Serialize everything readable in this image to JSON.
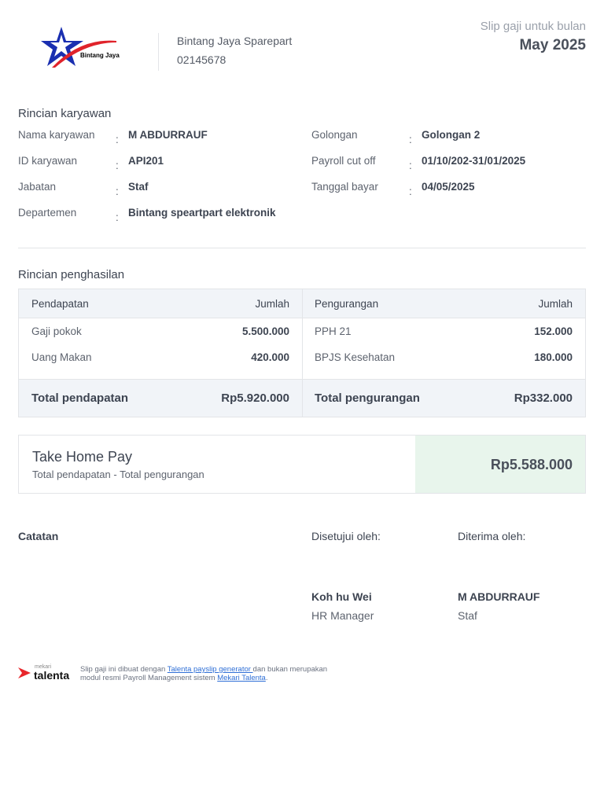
{
  "company": {
    "name": "Bintang Jaya Sparepart",
    "id": "02145678",
    "logo_text": "Bintang Jaya"
  },
  "slip": {
    "label": "Slip gaji untuk bulan",
    "month": "May 2025"
  },
  "employee": {
    "title": "Rincian karyawan",
    "sep": ":",
    "left": [
      {
        "label": "Nama karyawan",
        "value": "M ABDURRAUF"
      },
      {
        "label": "ID karyawan",
        "value": "API201"
      },
      {
        "label": "Jabatan",
        "value": "Staf"
      },
      {
        "label": "Departemen",
        "value": "Bintang speartpart elektronik"
      }
    ],
    "right": [
      {
        "label": "Golongan",
        "value": "Golongan 2"
      },
      {
        "label": "Payroll cut off",
        "value": "01/10/202-31/01/2025"
      },
      {
        "label": "Tanggal bayar",
        "value": "04/05/2025"
      }
    ]
  },
  "income": {
    "title": "Rincian penghasilan",
    "earnings": {
      "header": "Pendapatan",
      "amount_header": "Jumlah",
      "items": [
        {
          "label": "Gaji pokok",
          "value": "5.500.000"
        },
        {
          "label": "Uang Makan",
          "value": "420.000"
        }
      ],
      "total_label": "Total pendapatan",
      "total": "Rp5.920.000"
    },
    "deductions": {
      "header": "Pengurangan",
      "amount_header": "Jumlah",
      "items": [
        {
          "label": "PPH 21",
          "value": "152.000"
        },
        {
          "label": "BPJS Kesehatan",
          "value": "180.000"
        }
      ],
      "total_label": "Total pengurangan",
      "total": "Rp332.000"
    }
  },
  "take_home": {
    "title": "Take Home Pay",
    "subtitle": "Total pendapatan - Total pengurangan",
    "value": "Rp5.588.000"
  },
  "notes": {
    "label": "Catatan"
  },
  "approved": {
    "label": "Disetujui oleh:",
    "name": "Koh hu Wei",
    "role": "HR Manager"
  },
  "received": {
    "label": "Diterima oleh:",
    "name": "M ABDURRAUF",
    "role": "Staf"
  },
  "footer": {
    "brand_small": "mekari",
    "brand": "talenta",
    "text1": "Slip gaji ini dibuat dengan ",
    "link1": "Talenta payslip generator ",
    "text2": "dan bukan merupakan",
    "text3": "modul resmi Payroll Management sistem ",
    "link2": "Mekari Talenta",
    "text4": "."
  }
}
